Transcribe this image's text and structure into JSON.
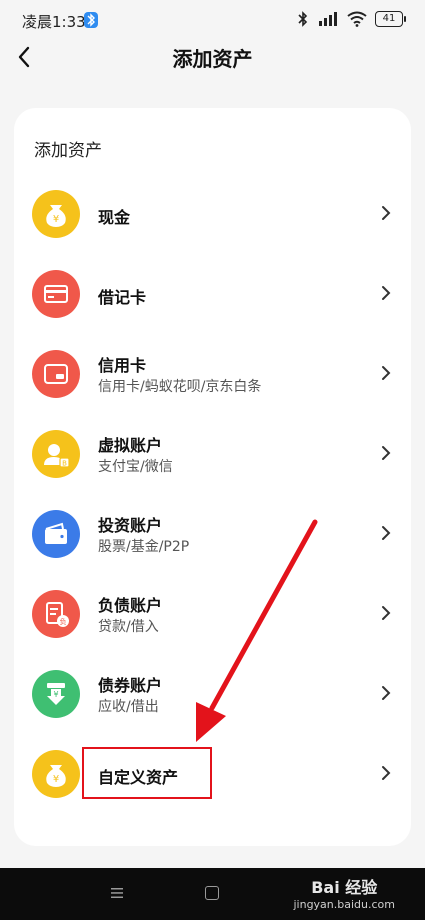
{
  "status_bar": {
    "time": "凌晨1:33",
    "battery": "41"
  },
  "header": {
    "title": "添加资产"
  },
  "section_title": "添加资产",
  "items": [
    {
      "name": "现金",
      "subtitle": "",
      "icon": "money-bag-icon",
      "color": "#f5c21b"
    },
    {
      "name": "借记卡",
      "subtitle": "",
      "icon": "debit-card-icon",
      "color": "#f0584a"
    },
    {
      "name": "信用卡",
      "subtitle": "信用卡/蚂蚁花呗/京东白条",
      "icon": "credit-card-icon",
      "color": "#f0584a"
    },
    {
      "name": "虚拟账户",
      "subtitle": "支付宝/微信",
      "icon": "virtual-account-icon",
      "color": "#f5c21b"
    },
    {
      "name": "投资账户",
      "subtitle": "股票/基金/P2P",
      "icon": "wallet-icon",
      "color": "#3b7be8"
    },
    {
      "name": "负债账户",
      "subtitle": "贷款/借入",
      "icon": "debt-icon",
      "color": "#f0584a"
    },
    {
      "name": "债券账户",
      "subtitle": "应收/借出",
      "icon": "bond-icon",
      "color": "#3fbf72"
    },
    {
      "name": "自定义资产",
      "subtitle": "",
      "icon": "money-bag-icon",
      "color": "#f5c21b"
    }
  ],
  "watermark": {
    "main": "Bai 经验",
    "sub": "jingyan.baidu.com"
  },
  "colors": {
    "annotation": "#e3131b"
  }
}
